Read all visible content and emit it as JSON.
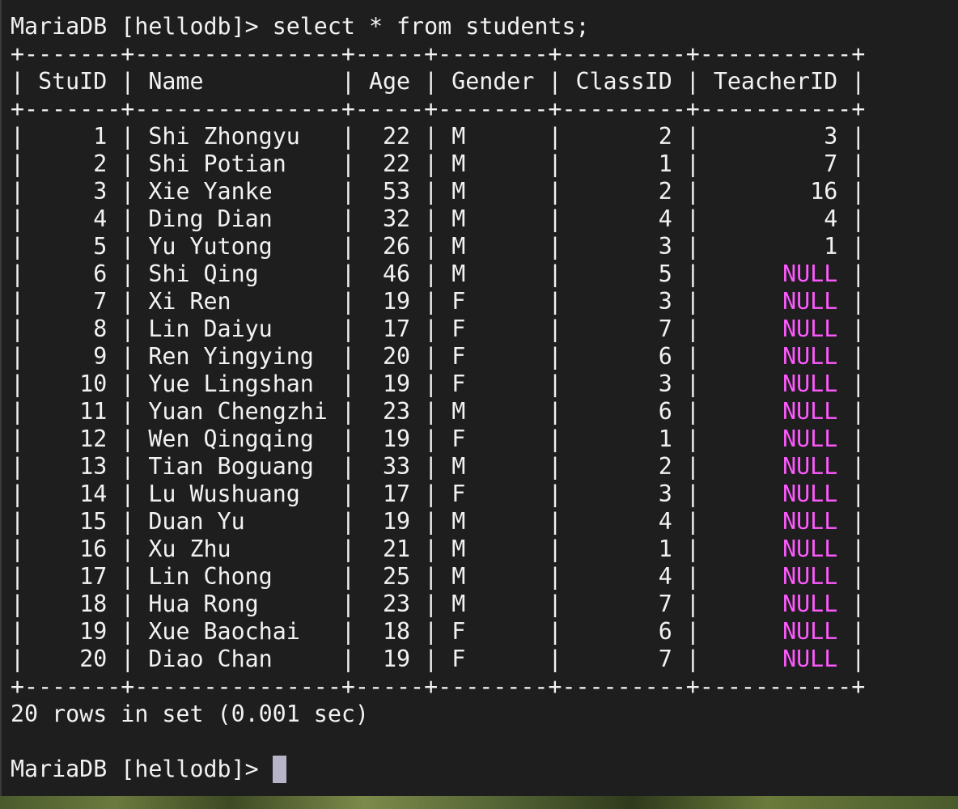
{
  "terminal": {
    "prompt": "MariaDB [hellodb]> ",
    "command": "select * from students;",
    "border_line": "+-------+---------------+-----+--------+---------+-----------+",
    "header_line": "| StuID | Name          | Age | Gender | ClassID | TeacherID |",
    "columns": [
      "StuID",
      "Name",
      "Age",
      "Gender",
      "ClassID",
      "TeacherID"
    ],
    "rows": [
      {
        "stuid": "1",
        "name": "Shi Zhongyu",
        "age": "22",
        "gender": "M",
        "classid": "2",
        "teacherid": "3"
      },
      {
        "stuid": "2",
        "name": "Shi Potian",
        "age": "22",
        "gender": "M",
        "classid": "1",
        "teacherid": "7"
      },
      {
        "stuid": "3",
        "name": "Xie Yanke",
        "age": "53",
        "gender": "M",
        "classid": "2",
        "teacherid": "16"
      },
      {
        "stuid": "4",
        "name": "Ding Dian",
        "age": "32",
        "gender": "M",
        "classid": "4",
        "teacherid": "4"
      },
      {
        "stuid": "5",
        "name": "Yu Yutong",
        "age": "26",
        "gender": "M",
        "classid": "3",
        "teacherid": "1"
      },
      {
        "stuid": "6",
        "name": "Shi Qing",
        "age": "46",
        "gender": "M",
        "classid": "5",
        "teacherid": "NULL"
      },
      {
        "stuid": "7",
        "name": "Xi Ren",
        "age": "19",
        "gender": "F",
        "classid": "3",
        "teacherid": "NULL"
      },
      {
        "stuid": "8",
        "name": "Lin Daiyu",
        "age": "17",
        "gender": "F",
        "classid": "7",
        "teacherid": "NULL"
      },
      {
        "stuid": "9",
        "name": "Ren Yingying",
        "age": "20",
        "gender": "F",
        "classid": "6",
        "teacherid": "NULL"
      },
      {
        "stuid": "10",
        "name": "Yue Lingshan",
        "age": "19",
        "gender": "F",
        "classid": "3",
        "teacherid": "NULL"
      },
      {
        "stuid": "11",
        "name": "Yuan Chengzhi",
        "age": "23",
        "gender": "M",
        "classid": "6",
        "teacherid": "NULL"
      },
      {
        "stuid": "12",
        "name": "Wen Qingqing",
        "age": "19",
        "gender": "F",
        "classid": "1",
        "teacherid": "NULL"
      },
      {
        "stuid": "13",
        "name": "Tian Boguang",
        "age": "33",
        "gender": "M",
        "classid": "2",
        "teacherid": "NULL"
      },
      {
        "stuid": "14",
        "name": "Lu Wushuang",
        "age": "17",
        "gender": "F",
        "classid": "3",
        "teacherid": "NULL"
      },
      {
        "stuid": "15",
        "name": "Duan Yu",
        "age": "19",
        "gender": "M",
        "classid": "4",
        "teacherid": "NULL"
      },
      {
        "stuid": "16",
        "name": "Xu Zhu",
        "age": "21",
        "gender": "M",
        "classid": "1",
        "teacherid": "NULL"
      },
      {
        "stuid": "17",
        "name": "Lin Chong",
        "age": "25",
        "gender": "M",
        "classid": "4",
        "teacherid": "NULL"
      },
      {
        "stuid": "18",
        "name": "Hua Rong",
        "age": "23",
        "gender": "M",
        "classid": "7",
        "teacherid": "NULL"
      },
      {
        "stuid": "19",
        "name": "Xue Baochai",
        "age": "18",
        "gender": "F",
        "classid": "6",
        "teacherid": "NULL"
      },
      {
        "stuid": "20",
        "name": "Diao Chan",
        "age": "19",
        "gender": "F",
        "classid": "7",
        "teacherid": "NULL"
      }
    ],
    "result_summary": "20 rows in set (0.001 sec)",
    "colors": {
      "background": "#1e1e1e",
      "text": "#f2f2f2",
      "null": "#ff5aff",
      "cursor": "#b8b4c8"
    }
  }
}
